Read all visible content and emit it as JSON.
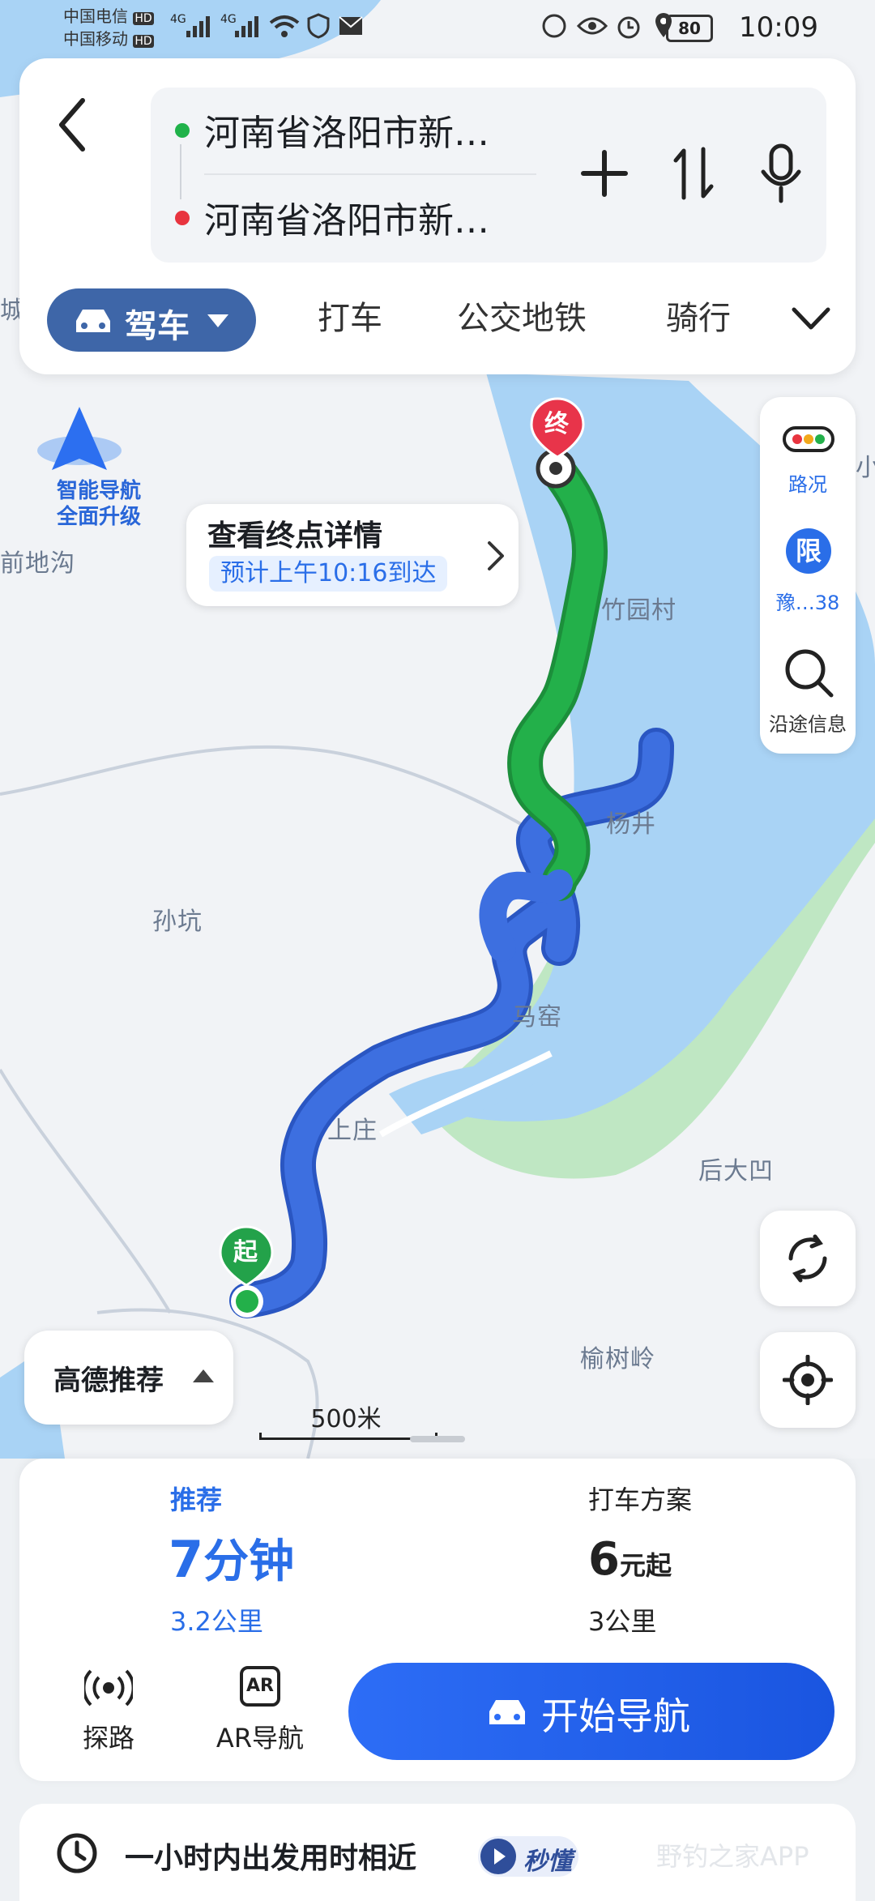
{
  "status_bar": {
    "carrier1": "中国电信",
    "carrier2": "中国移动",
    "hd": "HD",
    "net1": "4G",
    "net2": "4G",
    "battery": "80",
    "time": "10:09"
  },
  "route_panel": {
    "origin": "河南省洛阳市新…",
    "destination": "河南省洛阳市新…"
  },
  "modes": {
    "drive": "驾车",
    "taxi": "打车",
    "transit": "公交地铁",
    "bike": "骑行"
  },
  "map": {
    "ai_nav_line1": "智能导航",
    "ai_nav_line2": "全面升级",
    "labels": {
      "qiandigou": "前地沟",
      "zhuyuancun": "竹园村",
      "yangjing": "杨井",
      "sunkeng": "孙坑",
      "maoyao": "马窑",
      "shangzhuang": "上庄",
      "houdaao": "后大凹",
      "yushuling": "榆树岭",
      "edge_left": "城",
      "edge_right": "小"
    },
    "start_marker": "起",
    "end_marker": "终",
    "scale": "500米"
  },
  "callout": {
    "title": "查看终点详情",
    "eta": "预计上午10:16到达"
  },
  "tools": {
    "traffic": "路况",
    "limit_icon": "限",
    "limit": "豫…38",
    "along": "沿途信息"
  },
  "recommend_toggle": "高德推荐",
  "summary": {
    "recommended_label": "推荐",
    "duration_num": "7",
    "duration_unit": "分钟",
    "distance": "3.2公里",
    "taxi_label": "打车方案",
    "taxi_price_num": "6",
    "taxi_price_unit": "元起",
    "taxi_distance": "3公里"
  },
  "actions": {
    "explore": "探路",
    "ar_icon": "AR",
    "ar": "AR导航",
    "start_nav": "开始导航"
  },
  "bottom": {
    "hint": "一小时内出发用时相近",
    "badge": "秒懂",
    "watermark": "野钓之家APP"
  },
  "colors": {
    "route_blue": "#3d6fe0",
    "route_green": "#23b04a",
    "water": "#a9d3f5",
    "accent": "#2d6df6"
  }
}
